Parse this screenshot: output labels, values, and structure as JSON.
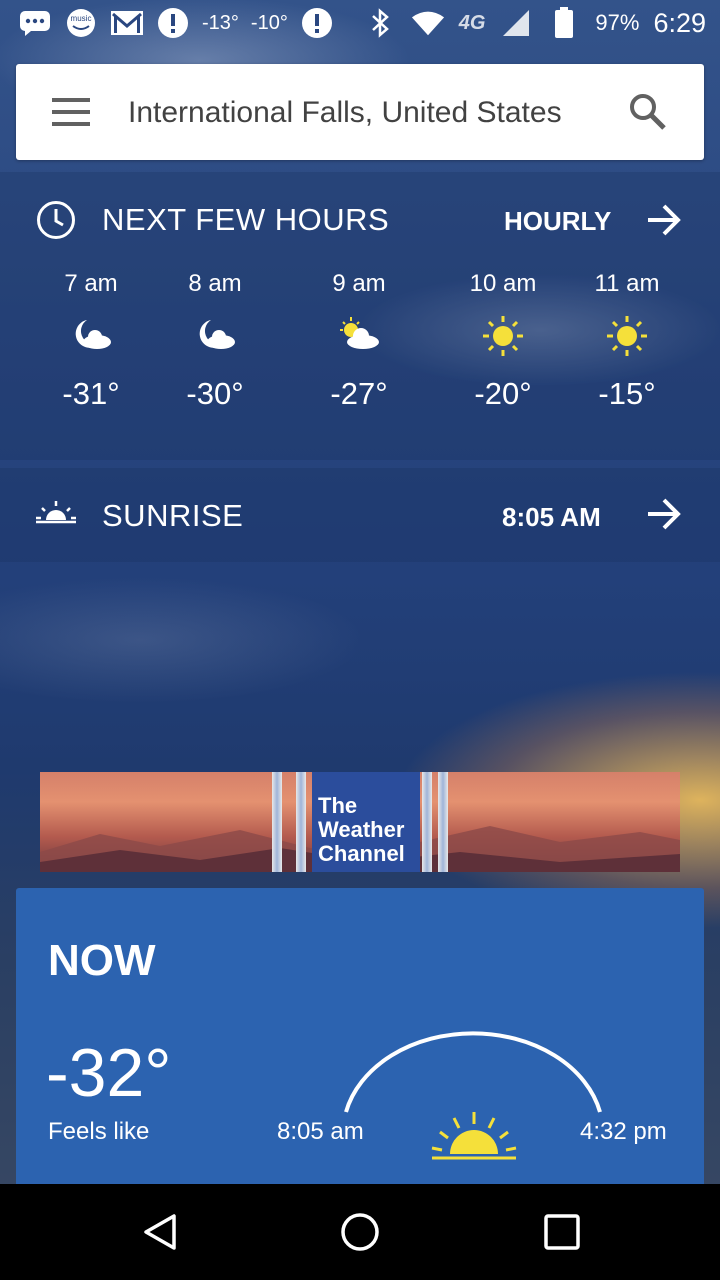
{
  "status_bar": {
    "temp_left": "-13°",
    "temp_right": "-10°",
    "network": "4G",
    "battery_percent": "97%",
    "time": "6:29",
    "icons": [
      "messages-icon",
      "amazon-music-icon",
      "gmail-icon",
      "alert-icon",
      "alert-icon",
      "bluetooth-icon",
      "wifi-icon",
      "signal-icon",
      "battery-icon"
    ]
  },
  "search": {
    "location": "International Falls, United States"
  },
  "next_hours": {
    "title": "NEXT FEW HOURS",
    "link_label": "HOURLY",
    "items": [
      {
        "time": "7 am",
        "temp": "-31°",
        "icon": "moon-cloud-icon"
      },
      {
        "time": "8 am",
        "temp": "-30°",
        "icon": "moon-cloud-icon"
      },
      {
        "time": "9 am",
        "temp": "-27°",
        "icon": "sun-cloud-icon"
      },
      {
        "time": "10 am",
        "temp": "-20°",
        "icon": "sun-icon"
      },
      {
        "time": "11 am",
        "temp": "-15°",
        "icon": "sun-icon"
      }
    ]
  },
  "sunrise": {
    "title": "SUNRISE",
    "time": "8:05 AM"
  },
  "ad": {
    "line1": "The",
    "line2": "Weather",
    "line3": "Channel"
  },
  "now": {
    "title": "NOW",
    "temp": "-32°",
    "feels_like_label": "Feels like",
    "sunrise_time": "8:05 am",
    "sunset_time": "4:32 pm"
  },
  "colors": {
    "card_blue": "#2c63b0",
    "sun_yellow": "#f5e03a",
    "search_text": "#424242"
  }
}
